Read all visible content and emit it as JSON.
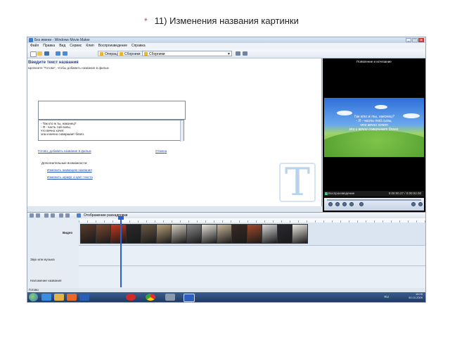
{
  "slide": {
    "bullet": "*",
    "title": "11) Изменения названия картинки"
  },
  "window": {
    "title": "Без имени - Windows Movie Maker",
    "buttons": [
      "_",
      "□",
      "x"
    ]
  },
  "menu": [
    "Файл",
    "Правка",
    "Вид",
    "Сервис",
    "Клип",
    "Воспроизведение",
    "Справка"
  ],
  "toolbar": {
    "tasks_button": "Операции",
    "collections_button": "Сборники",
    "collections_combo": "Сборники"
  },
  "title_panel": {
    "heading": "Введите текст названия",
    "instruction": "Щелкните \"Готово\", чтобы добавить название в фильм",
    "text_lines": [
      "- Так кто ж ты, наконец?",
      "- Я - часть той силы,",
      "что вечно хочет",
      "зла и вечно совершает благо."
    ],
    "done_link": "Готово, добавить название в фильм",
    "cancel_link": "Отмена",
    "more_options": "Дополнительные возможности:",
    "option_animation": "Изменить анимацию названия",
    "option_font": "Изменить шрифт и цвет текста",
    "logo_letter": "T"
  },
  "preview": {
    "title": "Появление и исчезание",
    "overlay_lines": [
      "Так кто ж ты, наконец?",
      "- Я - часть той силы,",
      "что вечно хочет",
      "зла и вечно совершает благо."
    ],
    "status": "Воспроизведение",
    "time": "0:00:00.27 / 0:00:02.00"
  },
  "timeline": {
    "view_label": "Отображение раскадровки",
    "track_video": "Видео",
    "track_audio": "Звук или музыка",
    "track_title": "Наложение названия",
    "clip_colors": [
      "#5a3a2a",
      "#7a4a30",
      "#c23a22",
      "#2a2a2a",
      "#6b5a44",
      "#b9a07a",
      "#d8d2c4",
      "#8a8a8a",
      "#e8e4dc",
      "#c9b79a",
      "#3a2a24",
      "#a24a2a",
      "#d8d8d8",
      "#2a2a30",
      "#efece6"
    ]
  },
  "statusbar": {
    "text": "Готово"
  },
  "taskbar": {
    "lang": "RU",
    "time": "16:05",
    "date": "30.10.2009",
    "apps": [
      "ie-icon",
      "explorer-icon",
      "media-player-icon",
      "word-icon",
      "opera-icon",
      "chrome-icon",
      "movie-maker-icon",
      "word-doc-icon"
    ]
  }
}
